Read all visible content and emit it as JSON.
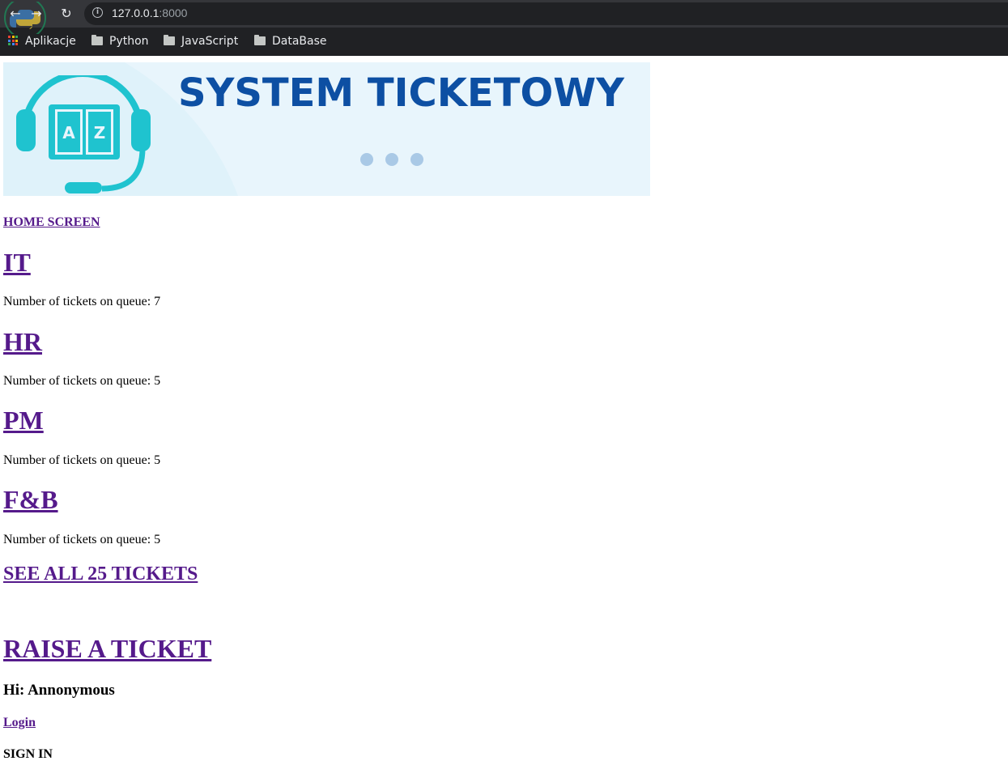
{
  "browser": {
    "url_host": "127.0.0.1",
    "url_port": ":8000",
    "bookmarks": [
      {
        "label": "Aplikacje",
        "icon": "apps-grid-icon"
      },
      {
        "label": "Python",
        "icon": "folder-icon"
      },
      {
        "label": "JavaScript",
        "icon": "folder-icon"
      },
      {
        "label": "DataBase",
        "icon": "folder-icon"
      }
    ]
  },
  "banner": {
    "title": "SYSTEM TICKETOWY",
    "book_letter_left": "A",
    "book_letter_right": "Z"
  },
  "page": {
    "home_link": "HOME SCREEN",
    "departments": [
      {
        "name": "IT",
        "queue_text": "Number of tickets on queue: 7"
      },
      {
        "name": "HR",
        "queue_text": "Number of tickets on queue: 5"
      },
      {
        "name": "PM",
        "queue_text": "Number of tickets on queue: 5"
      },
      {
        "name": "F&B",
        "queue_text": "Number of tickets on queue: 5"
      }
    ],
    "see_all": "SEE ALL 25 TICKETS",
    "raise": "RAISE A TICKET",
    "greeting": "Hi: Annonymous",
    "login": "Login",
    "sign_in": "SIGN IN"
  },
  "colors": {
    "link": "#551a8b",
    "banner_bg": "#e8f5fc",
    "banner_title": "#0d4fa3",
    "headset": "#1fc3cf"
  }
}
